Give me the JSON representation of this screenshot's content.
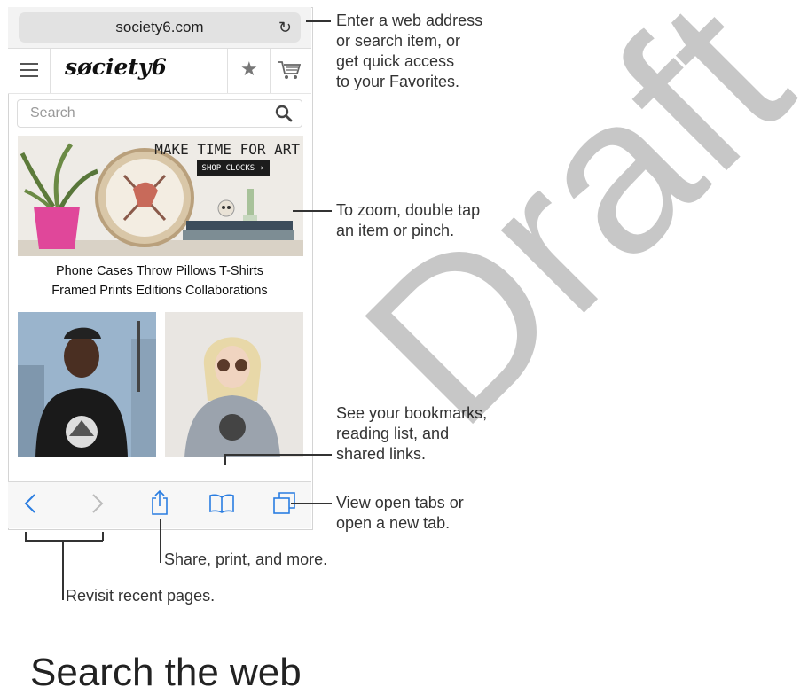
{
  "browser": {
    "url": "society6.com",
    "reload_icon": "reload-icon"
  },
  "site": {
    "logo": "søciety6",
    "search_placeholder": "Search",
    "hero_title": "MAKE TIME FOR ART",
    "hero_button": "SHOP CLOCKS ›",
    "categories_row1": "Phone Cases   Throw Pillows   T-Shirts",
    "categories_row2": "Framed Prints   Editions   Collaborations",
    "icons": [
      "menu-icon",
      "star-icon",
      "cart-icon",
      "search-icon"
    ]
  },
  "toolbar": {
    "icons": [
      "back-icon",
      "forward-icon",
      "share-icon",
      "bookmarks-icon",
      "tabs-icon"
    ]
  },
  "callouts": {
    "address": [
      "Enter a web address",
      "or search item, or",
      "get quick access",
      "to your Favorites."
    ],
    "zoom": [
      "To zoom, double tap",
      "an item or pinch."
    ],
    "bookmarks": [
      "See your bookmarks,",
      "reading list, and",
      "shared links."
    ],
    "tabs": [
      "View open tabs or",
      "open a new tab."
    ],
    "share": "Share, print, and more.",
    "revisit": "Revisit recent pages."
  },
  "watermark": "Draft",
  "heading": "Search the web"
}
